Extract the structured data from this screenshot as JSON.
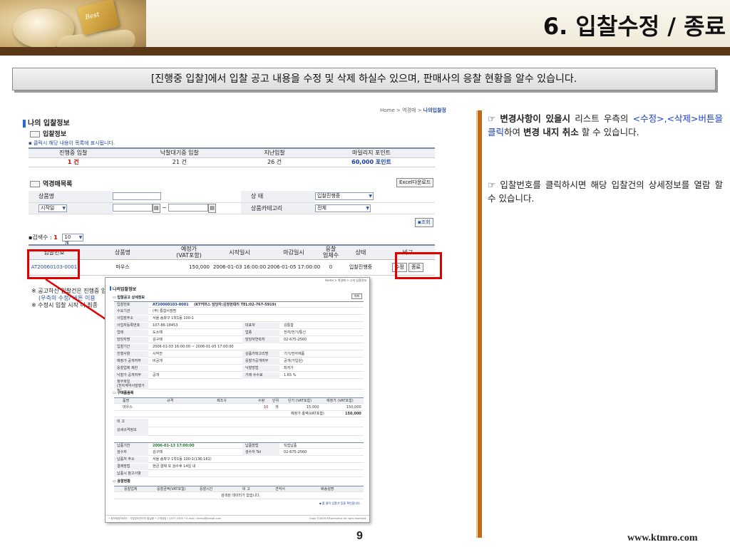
{
  "header": {
    "title": "6. 입찰수정 / 종료",
    "logo_card": "Best"
  },
  "subtitle": "[진행중 입찰]에서 입찰 공고 내용을 수정 및 삭제 하실수 있으며, 판매사의 응찰 현황을 알수 있습니다.",
  "screen": {
    "breadcrumb": {
      "home": "Home",
      "sep": ">",
      "mid": "역경매",
      "current": "나의입찰정"
    },
    "title": "나의 입찰정보",
    "section1": "입찰정보",
    "hint": "▪ 클릭시 해당 내용이 목록에 표시됩니다.",
    "summary": {
      "headers": [
        "진행중 입찰",
        "낙찰대기중 입찰",
        "지난입찰",
        "마일리지 포인트"
      ],
      "values": [
        "1 건",
        "21 건",
        "26 건",
        "60,000 포인트"
      ]
    },
    "section2": "역경매목록",
    "excel_button": "Excel다운로드",
    "search": {
      "product_label": "상품명",
      "product_value": "",
      "status_label": "상 태",
      "status_value": "입찰진행중",
      "period_select": "시작일",
      "tilde": "~",
      "category_label": "상품카테고리",
      "category_value": "전체",
      "search_button": "조회"
    },
    "count_label": "▪검색수 :",
    "count_value": "1",
    "per_page": "10개",
    "table": {
      "headers": [
        "입찰번호",
        "상품명",
        "예정가\n(VAT포함)",
        "시작일시",
        "마감일시",
        "응찰\n업체수",
        "상태",
        "비고"
      ],
      "row": {
        "no": "AT20060103-0001",
        "product": "마우스",
        "price": "150,000",
        "start": "2006-01-03 16:00:00",
        "end": "2006-01-05 17:00:00",
        "bidders": "0",
        "status": "입찰진행중",
        "edit": "수정",
        "close": "종료"
      }
    },
    "notes": [
      "※ 공고하신 입찰건은 진행중 입",
      "(우측의 수정/",
      "버튼 이용",
      "※ 수정시 입찰 시작",
      "이 최종"
    ]
  },
  "popup": {
    "breadcrumb": "Home > 역경매 > 나의 입찰정보",
    "title": "나의입찰정보",
    "section": "입찰공고 상세정보",
    "list_button": "목록",
    "bid_no_label": "입찰번호",
    "bid_no": "AT20060103-0001",
    "bid_no_note": "(KT커머스 담당자:김정현대리 TEL:02-767-5919)",
    "rows": [
      [
        "수요기관",
        "(주) 통합서점명",
        "",
        ""
      ],
      [
        "사업장주소",
        "서울 송파구 1학1동 100-1",
        "",
        ""
      ],
      [
        "사업자등록번호",
        "107-86-18453",
        "대표자",
        "김통합"
      ],
      [
        "업태",
        "도소매",
        "업종",
        "전자/전기/통신"
      ],
      [
        "담당자명",
        "김구매",
        "담당자연락처",
        "02-675-2560"
      ],
      [
        "입찰기간",
        "2006-01-03 16:00:00 ~ 2006-01-05 17:00:00",
        "",
        ""
      ],
      [
        "진행사항",
        "시작전",
        "상품카테고리명",
        "기기/전자제품"
      ],
      [
        "예정가 공개여부",
        "비공개",
        "응찰가공개여부",
        "공개(가입원)"
      ],
      [
        "응찰업체 제한",
        "",
        "낙찰방법",
        "최저가"
      ],
      [
        "낙찰가 공개여부",
        "공개",
        "거래 수수료",
        "1.65 %"
      ],
      [
        "첨부파일\n(전자계약서발행가능)",
        "",
        "",
        ""
      ]
    ],
    "purchase_section": "구매품몸록",
    "purchase_headers": [
      "품명",
      "규격",
      "제조사",
      "수량",
      "단위",
      "단가 (VAT포함)",
      "예정가 (VAT포함)"
    ],
    "purchase_row": [
      "마우스",
      "",
      "",
      "10",
      "개",
      "15,000",
      "150,000"
    ],
    "total_label": "예정가 총액(VAT포함)",
    "total_value": "150,000",
    "remarks_label": "비 고",
    "items_label": "상세규격정보",
    "delivery": [
      [
        "납품기한",
        "2006-01-13 17:00:00",
        "납품방법",
        "직접납품"
      ],
      [
        "검수자",
        "김구매",
        "검수자 Tel",
        "02-675-2560"
      ],
      [
        "납품처 주소",
        "서울 송파구 1학1동 100-1(136-161)",
        "",
        ""
      ],
      [
        "결제방법",
        "현금 결제 또 검수후 14일 내",
        "",
        ""
      ],
      [
        "납품시 참고사항",
        "",
        "",
        ""
      ]
    ],
    "bid_section": "응찰현황",
    "bid_headers": [
      "응찰업체",
      "응찰금액(VAT포함)",
      "응찰시간",
      "비 고",
      "견적서",
      "배송설명"
    ],
    "bid_empty": "검색된 데이터가 없습니다.",
    "bid_note": "▪ 를 클릭 입찰가 등을 확인합니다.",
    "footer_left": "• 정보제공처리자 : 기업정보관리자 홍길동 • 고객상담 / 1577-1500 • E-mail / ktmro@ktmall.com",
    "footer_right": "Copy ©2004 KTcommerce All right reserved."
  },
  "right_text": {
    "p1_a": "☞ ",
    "p1_b": "변경사항이 있을시",
    "p1_c": " 리스트 우측의 ",
    "p1_d": "<수정>,<삭제>버튼을 클릭",
    "p1_e": "하여 ",
    "p1_f": "변경 내지 취소",
    "p1_g": " 할 수 있습니다.",
    "p2": "☞ 입찰번호를 클릭하시면 해당 입찰건의 상세정보를 열람 할 수 있습니다."
  },
  "page_number": "9",
  "site": "www.ktmro.com",
  "colors": {
    "header_bar": "#5a3717",
    "accent_bar": "#c46a14",
    "highlight": "#e00000",
    "link": "#1a3ec8"
  }
}
